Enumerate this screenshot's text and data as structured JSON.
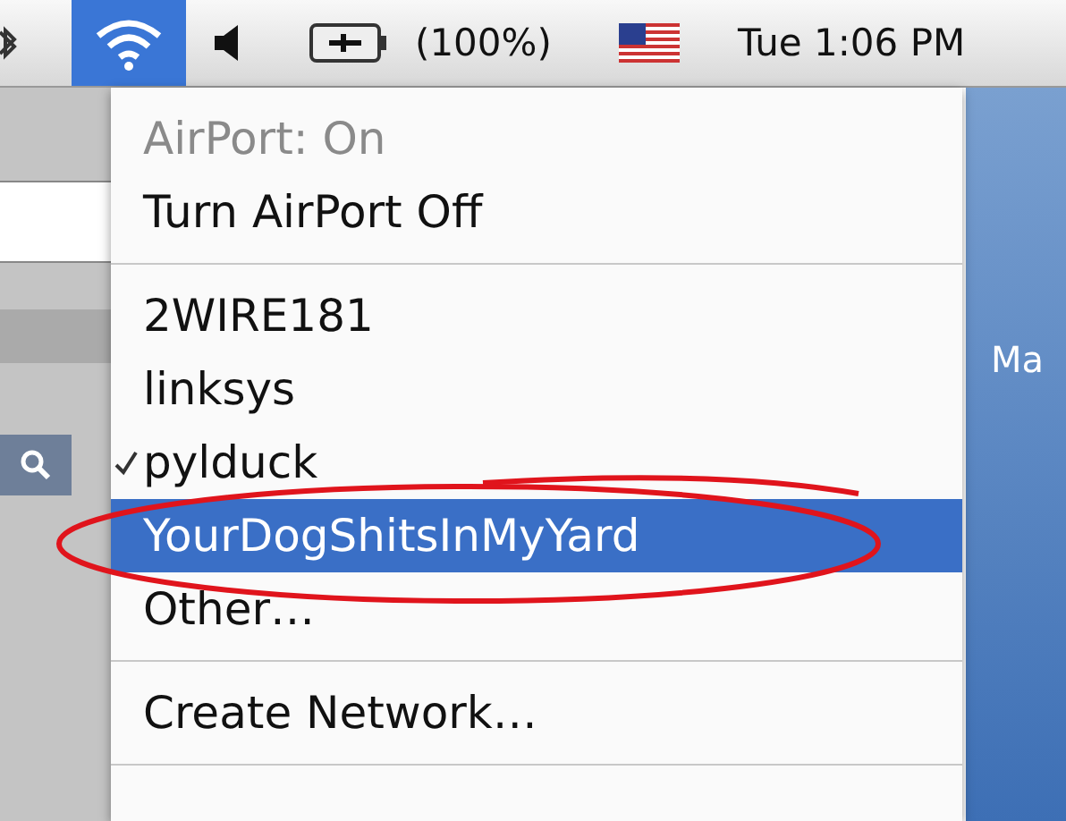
{
  "menubar": {
    "wifi_open": true,
    "battery": "(100%)",
    "clock": "Tue 1:06 PM"
  },
  "menu": [
    {
      "kind": "item",
      "label": "AirPort: On",
      "disabled": true,
      "checked": false,
      "selected": false
    },
    {
      "kind": "item",
      "label": "Turn AirPort Off",
      "disabled": false,
      "checked": false,
      "selected": false
    },
    {
      "kind": "separator"
    },
    {
      "kind": "item",
      "label": "2WIRE181",
      "disabled": false,
      "checked": false,
      "selected": false
    },
    {
      "kind": "item",
      "label": "linksys",
      "disabled": false,
      "checked": false,
      "selected": false
    },
    {
      "kind": "item",
      "label": "pylduck",
      "disabled": false,
      "checked": true,
      "selected": false
    },
    {
      "kind": "item",
      "label": "YourDogShitsInMyYard",
      "disabled": false,
      "checked": false,
      "selected": true
    },
    {
      "kind": "item",
      "label": "Other…",
      "disabled": false,
      "checked": false,
      "selected": false
    },
    {
      "kind": "separator"
    },
    {
      "kind": "item",
      "label": "Create Network…",
      "disabled": false,
      "checked": false,
      "selected": false
    },
    {
      "kind": "separator"
    }
  ],
  "desktop": {
    "label": "Ma"
  }
}
